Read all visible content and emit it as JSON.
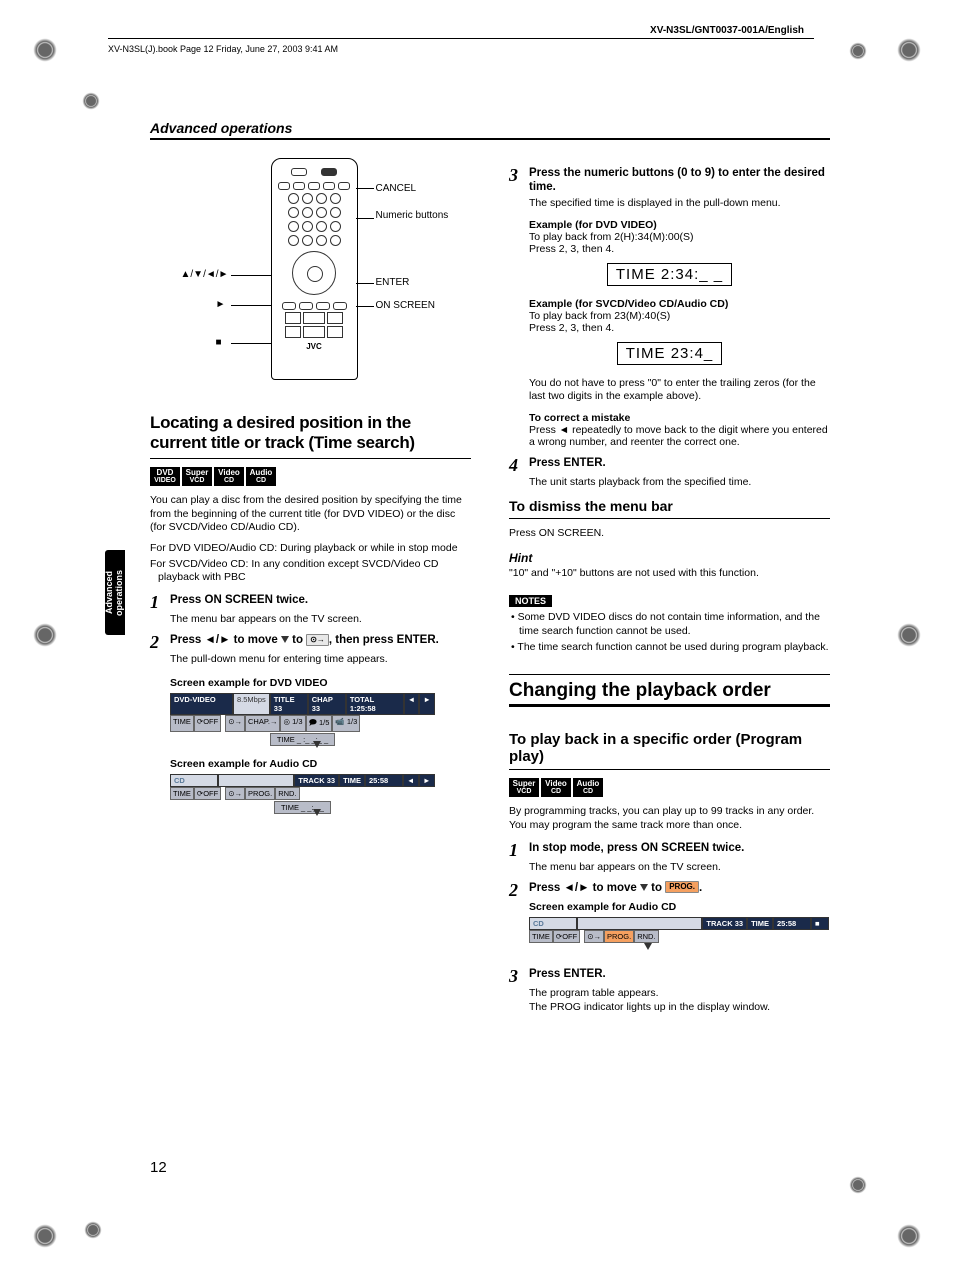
{
  "header": {
    "doc_model": "XV-N3SL/GNT0037-001A/English",
    "book_info": "XV-N3SL(J).book  Page 12  Friday, June 27, 2003  9:41 AM"
  },
  "section_title": "Advanced operations",
  "side_tab": "Advanced operations",
  "page_number": "12",
  "remote": {
    "labels": {
      "cancel": "CANCEL",
      "numeric": "Numeric buttons",
      "arrows": "▲/▼/◄/►",
      "play": "►",
      "stop": "■",
      "enter": "ENTER",
      "onscreen": "ON SCREEN",
      "brand": "JVC"
    }
  },
  "left": {
    "heading": "Locating a desired position in the current title or track (Time search)",
    "badges": [
      "DVD VIDEO",
      "Super VCD",
      "Video CD",
      "Audio CD"
    ],
    "intro": "You can play a disc from the desired position by specifying the time from the beginning of the current title (for DVD VIDEO) or the disc (for SVCD/Video CD/Audio CD).",
    "cond1": "For DVD VIDEO/Audio CD: During playback or while in stop mode",
    "cond2": "For SVCD/Video CD: In any condition except SVCD/Video CD playback with PBC",
    "step1": "Press ON SCREEN twice.",
    "step1_sub": "The menu bar appears on the TV screen.",
    "step2_a": "Press ◄/► to move ",
    "step2_b": " to ",
    "step2_c": ", then press ENTER.",
    "step2_sub": "The pull-down menu for entering time appears.",
    "example_dvd_label": "Screen example for DVD VIDEO",
    "menubar_dvd": {
      "title_left": "DVD-VIDEO",
      "rate": "8.5Mbps",
      "title": "TITLE 33",
      "chap": "CHAP 33",
      "total": "TOTAL 1:25:58",
      "row2_time": "TIME",
      "row2_off": "OFF",
      "row2_chap": "CHAP.",
      "row2_13a": "1/3",
      "row2_15": "1/5",
      "row2_13b": "1/3",
      "dropdown": "TIME    _ :_ _:_ _"
    },
    "example_cd_label": "Screen example for Audio CD",
    "menubar_cd": {
      "title_left": "CD",
      "track": "TRACK 33",
      "time_lbl": "TIME",
      "time_val": "25:58",
      "row2_time": "TIME",
      "row2_off": "OFF",
      "row2_prog": "PROG.",
      "row2_rnd": "RND.",
      "dropdown": "TIME      _ _:_ _"
    }
  },
  "right": {
    "step3": "Press the numeric buttons (0 to 9) to enter the desired time.",
    "step3_sub": "The specified time is displayed in the pull-down menu.",
    "ex_dvd_title": "Example (for DVD VIDEO)",
    "ex_dvd_l1": "To play back from 2(H):34(M):00(S)",
    "ex_dvd_l2": "Press 2, 3, then 4.",
    "ex_dvd_box": "TIME   2:34:_ _",
    "ex_cd_title": "Example (for SVCD/Video CD/Audio CD)",
    "ex_cd_l1": "To play back from 23(M):40(S)",
    "ex_cd_l2": "Press 2, 3, then 4.",
    "ex_cd_box": "TIME     23:4_",
    "trailing_note": "You do not have to press \"0\" to enter the trailing zeros (for the last two digits in the example above).",
    "correct_title": "To correct a mistake",
    "correct_body": "Press ◄ repeatedly to move back to the digit where you entered a wrong number, and reenter the correct one.",
    "step4": "Press ENTER.",
    "step4_sub": "The unit starts playback from the specified time.",
    "dismiss_title": "To dismiss the menu bar",
    "dismiss_body": "Press ON SCREEN.",
    "hint_title": "Hint",
    "hint_body": "\"10\" and \"+10\" buttons are not used with this function.",
    "notes_label": "NOTES",
    "note1": "Some DVD VIDEO discs do not contain time information, and the time search function cannot be used.",
    "note2": "The time search function cannot be used during program playback.",
    "changing_title": "Changing the playback order",
    "program_title": "To play back in a specific order (Program play)",
    "program_badges": [
      "Super VCD",
      "Video CD",
      "Audio CD"
    ],
    "program_intro": "By programming tracks, you can play up to 99 tracks in any order. You may program the same track more than once.",
    "pstep1": "In stop mode, press ON SCREEN twice.",
    "pstep1_sub": "The menu bar appears on the TV screen.",
    "pstep2_a": "Press ◄/► to move ",
    "pstep2_b": " to ",
    "pstep2_c": ".",
    "pstep2_sub": "Screen example for Audio CD",
    "menubar_prog": {
      "title_left": "CD",
      "track": "TRACK 33",
      "time_lbl": "TIME",
      "time_val": "25:58",
      "row2_time": "TIME",
      "row2_off": "OFF",
      "row2_prog": "PROG.",
      "row2_rnd": "RND."
    },
    "prog_label": "PROG.",
    "pstep3": "Press ENTER.",
    "pstep3_sub1": "The program table appears.",
    "pstep3_sub2": "The PROG indicator lights up in the display window."
  }
}
